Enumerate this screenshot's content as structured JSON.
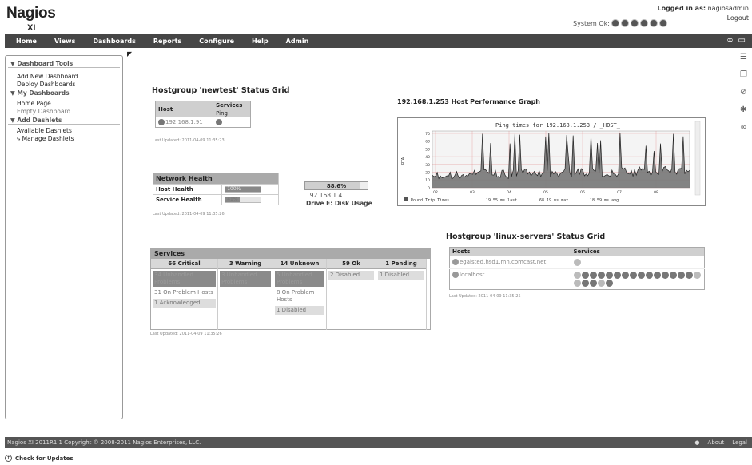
{
  "app": {
    "logo_main": "Nagios",
    "logo_sub": "XI"
  },
  "header": {
    "logged_in_label": "Logged in as:",
    "logged_in_user": "nagiosadmin",
    "logout": "Logout",
    "system_ok_label": "System Ok:"
  },
  "nav": {
    "items": [
      "Home",
      "Views",
      "Dashboards",
      "Reports",
      "Configure",
      "Help",
      "Admin"
    ]
  },
  "sidebar": {
    "sections": [
      {
        "title": "Dashboard Tools",
        "items": [
          "Add New Dashboard",
          "Deploy Dashboards"
        ]
      },
      {
        "title": "My Dashboards",
        "items": [
          "Home Page",
          "Empty Dashboard"
        ]
      },
      {
        "title": "Add Dashlets",
        "items": [
          "Available Dashlets",
          "Manage Dashlets"
        ]
      }
    ]
  },
  "hostgroup_newtest": {
    "title": "Hostgroup 'newtest' Status Grid",
    "col_host": "Host",
    "col_services": "Services",
    "service_name": "Ping",
    "host": "192.168.1.91",
    "updated": "Last Updated: 2011-04-09 11:35:23"
  },
  "network_health": {
    "title": "Network Health",
    "host_label": "Host Health",
    "service_label": "Service Health",
    "host_value": "100%",
    "host_pct": 100,
    "service_value": "41%",
    "service_pct": 41,
    "updated": "Last Updated: 2011-04-09 11:35:26"
  },
  "disk": {
    "value": "88.6%",
    "pct": 88.6,
    "host": "192.168.1.4",
    "label": "Drive E: Disk Usage"
  },
  "perf": {
    "title": "192.168.1.253 Host Performance Graph",
    "graph_title": "Ping times for  192.168.1.253 / _HOST_",
    "ylabel": "RTA",
    "yticks": [
      "70",
      "60",
      "50",
      "40",
      "30",
      "20",
      "10",
      "0"
    ],
    "xticks": [
      "02",
      "03",
      "04",
      "05",
      "06",
      "07",
      "08"
    ],
    "legend_series": "Round Trip Times",
    "legend_last": "19.55 ms last",
    "legend_max": "68.19 ms max",
    "legend_avg": "18.59 ms avg"
  },
  "services": {
    "title": "Services",
    "columns": [
      {
        "header": "66 Critical",
        "cells": [
          {
            "text": "34 Unhandled Problems",
            "style": "dark"
          },
          {
            "text": "31 On Problem Hosts",
            "style": "plain"
          },
          {
            "text": "1 Acknowledged",
            "style": "light"
          }
        ]
      },
      {
        "header": "3 Warning",
        "cells": [
          {
            "text": "3 Unhandled Problems",
            "style": "dark"
          }
        ]
      },
      {
        "header": "14 Unknown",
        "cells": [
          {
            "text": "5 Unhandled Problems",
            "style": "dark"
          },
          {
            "text": "8 On Problem Hosts",
            "style": "plain"
          },
          {
            "text": "1 Disabled",
            "style": "light"
          }
        ]
      },
      {
        "header": "59 Ok",
        "cells": [
          {
            "text": "2 Disabled",
            "style": "light"
          }
        ]
      },
      {
        "header": "1 Pending",
        "cells": [
          {
            "text": "1 Disabled",
            "style": "light"
          }
        ]
      }
    ],
    "updated": "Last Updated: 2011-04-09 11:35:26"
  },
  "hostgroup_linux": {
    "title": "Hostgroup 'linux-servers' Status Grid",
    "col_hosts": "Hosts",
    "col_services": "Services",
    "hosts": [
      "egalsted.hsd1.mn.comcast.net",
      "localhost"
    ],
    "updated": "Last Updated: 2011-04-09 11:35:25"
  },
  "footer": {
    "copyright": "Nagios XI 2011R1.1 Copyright © 2008-2011 Nagios Enterprises, LLC.",
    "about": "About",
    "legal": "Legal",
    "check_updates": "Check for Updates"
  }
}
